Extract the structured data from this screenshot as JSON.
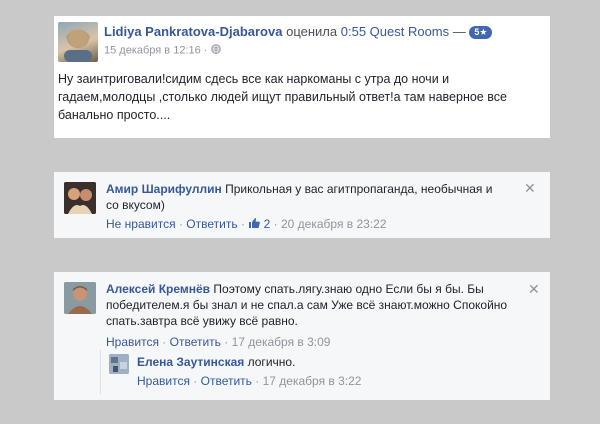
{
  "review": {
    "author": "Lidiya Pankratova-Djabarova",
    "action": "оценила",
    "target": "0:55 Quest Rooms",
    "dash": "—",
    "rating_badge": "5★",
    "timestamp": "15 декабря в 12:16",
    "separator": "·",
    "body": "Ну заинтриговали!сидим сдесь все как наркоманы с утра до ночи и гадаем,молодцы ,столько людей ищут правильный ответ!а там наверное все банально просто...."
  },
  "comments": [
    {
      "author": "Амир Шарифуллин",
      "text": "Прикольная у вас агитпропаганда, необычная и со вкусом)",
      "unlike": "Не нравится",
      "reply": "Ответить",
      "likes": "2",
      "time": "20 декабря в 23:22",
      "sep": "·"
    },
    {
      "author": "Алексей Кремнёв",
      "text": "Поэтому спать.лягу.знаю одно Если бы я бы. Бы победителем.я бы знал и не спал.а сам Уже всё знают.можно Спокойно спать.завтра всё увижу всё равно.",
      "like": "Нравится",
      "reply": "Ответить",
      "time": "17 декабря в 3:09",
      "sep": "·",
      "reply_item": {
        "author": "Елена Заутинская",
        "text": "логично.",
        "like": "Нравится",
        "reply": "Ответить",
        "time": "17 декабря в 3:22",
        "sep": "·"
      }
    }
  ],
  "close_glyph": "✕",
  "colors": {
    "link": "#365899",
    "meta": "#90949c",
    "badge": "#4267b2"
  }
}
